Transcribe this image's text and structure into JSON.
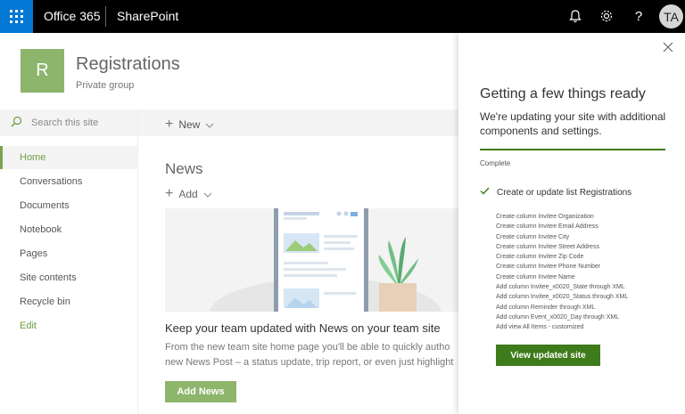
{
  "suitebar": {
    "brand": "Office 365",
    "product": "SharePoint",
    "avatar_initials": "TA",
    "accent": "#0078d4"
  },
  "site": {
    "logo_letter": "R",
    "title": "Registrations",
    "subtitle": "Private group",
    "logo_color": "#8db56c"
  },
  "command": {
    "new_label": "New"
  },
  "leftnav": {
    "search_placeholder": "Search this site",
    "items": [
      {
        "label": "Home",
        "active": true
      },
      {
        "label": "Conversations"
      },
      {
        "label": "Documents"
      },
      {
        "label": "Notebook"
      },
      {
        "label": "Pages"
      },
      {
        "label": "Site contents"
      },
      {
        "label": "Recycle bin"
      },
      {
        "label": "Edit"
      }
    ]
  },
  "news": {
    "title": "News",
    "add_label": "Add",
    "headline": "Keep your team updated with News on your team site",
    "body_line1": "From the new team site home page you'll be able to quickly autho",
    "body_line2": "new News Post – a status update, trip report, or even just highlight",
    "add_news_label": "Add News"
  },
  "panel": {
    "title": "Getting a few things ready",
    "description": "We're updating your site with additional components and settings.",
    "progress_fraction": 1.0,
    "status": "Complete",
    "task": "Create or update list Registrations",
    "steps": [
      "Create column Invitee Organization",
      "Create column Invitee Email Address",
      "Create column Invitee City",
      "Create column Invitee Street Address",
      "Create column Invitee Zip Code",
      "Create column Invitee Phone Number",
      "Create column Invitee Name",
      "Add column Invitee_x0020_State through XML",
      "Add column Invitee_x0020_Status through XML",
      "Add column Reminder through XML",
      "Add column Event_x0020_Day through XML",
      "Add view All Items - customized"
    ],
    "view_button": "View updated site",
    "accent": "#3e7b1b"
  }
}
